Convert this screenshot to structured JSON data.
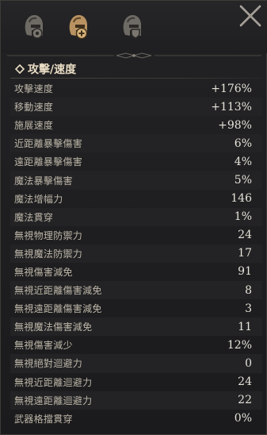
{
  "tabs": [
    {
      "icon": "helmet-gear-icon"
    },
    {
      "icon": "helmet-plus-icon",
      "active": true
    },
    {
      "icon": "helmet-shield-icon"
    }
  ],
  "section": {
    "title": "攻擊/速度"
  },
  "stats": [
    {
      "label": "攻擊速度",
      "value": "+176%"
    },
    {
      "label": "移動速度",
      "value": "+113%"
    },
    {
      "label": "施展速度",
      "value": "+98%"
    },
    {
      "label": "近距離暴擊傷害",
      "value": "6%"
    },
    {
      "label": "遠距離暴擊傷害",
      "value": "4%"
    },
    {
      "label": "魔法暴擊傷害",
      "value": "5%"
    },
    {
      "label": "魔法增幅力",
      "value": "146"
    },
    {
      "label": "魔法貫穿",
      "value": "1%"
    },
    {
      "label": "無視物理防禦力",
      "value": "24"
    },
    {
      "label": "無視魔法防禦力",
      "value": "17"
    },
    {
      "label": "無視傷害減免",
      "value": "91"
    },
    {
      "label": "無視近距離傷害減免",
      "value": "8"
    },
    {
      "label": "無視遠距離傷害減免",
      "value": "3"
    },
    {
      "label": "無視魔法傷害減免",
      "value": "11"
    },
    {
      "label": "無視傷害減少",
      "value": "12%"
    },
    {
      "label": "無視絕對迴避力",
      "value": "0"
    },
    {
      "label": "無視近距離迴避力",
      "value": "24"
    },
    {
      "label": "無視遠距離迴避力",
      "value": "22"
    },
    {
      "label": "武器格擋貫穿",
      "value": "0%"
    }
  ],
  "colors": {
    "accent_gold": "#c9a46a",
    "label": "#bdb6a8",
    "value": "#e6e2d9",
    "background": "#1d1d1f"
  }
}
